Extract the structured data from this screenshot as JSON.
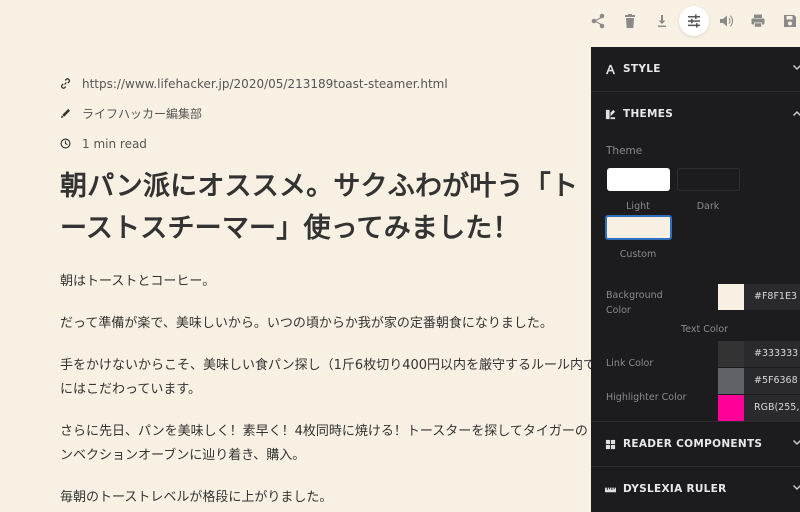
{
  "toolbar": {
    "buttons": [
      {
        "name": "share-icon",
        "label": "share"
      },
      {
        "name": "trash-icon",
        "label": "delete"
      },
      {
        "name": "download-icon",
        "label": "download"
      },
      {
        "name": "sliders-icon",
        "label": "settings"
      },
      {
        "name": "speaker-icon",
        "label": "read aloud"
      },
      {
        "name": "print-icon",
        "label": "print"
      },
      {
        "name": "save-icon",
        "label": "save"
      }
    ]
  },
  "article": {
    "url": "https://www.lifehacker.jp/2020/05/213189toast-steamer.html",
    "author": "ライフハッカー編集部",
    "read_time": "1 min read",
    "title_line1": "朝パン派にオススメ。サクふわが叶う「ト",
    "title_line2": "ーストスチーマー」使ってみました！",
    "paragraphs": [
      "朝はトーストとコーヒー。",
      "だって準備が楽で、美味しいから。いつの頃からか我が家の定番朝食になりました。",
      "手をかけないからこそ、美味しい食パン探し（1斤6枚切り400円以内を厳守するルール内で",
      "にはこだわっています。",
      "さらに先日、パンを美味しく！素早く！4枚同時に焼ける！トースターを探してタイガーの",
      "ンベクションオーブンに辿り着き、購入。",
      "毎朝のトーストレベルが格段に上がりました。"
    ]
  },
  "panel": {
    "style_label": "STYLE",
    "themes_label": "THEMES",
    "theme_heading": "Theme",
    "themes": [
      {
        "label": "Light",
        "color": "#FFFFFF"
      },
      {
        "label": "Dark",
        "color": "#1C1C1F"
      },
      {
        "label": "Custom",
        "color": "#F8F1E3"
      }
    ],
    "background_color_label": "Background Color",
    "background_color_value": "#F8F1E3",
    "text_color_label": "Text Color",
    "text_color_value": "#333333",
    "link_color_label": "Link Color",
    "link_color_value": "#5F6368",
    "highlighter_color_label": "Highlighter Color",
    "highlighter_color_value": "RGB(255,",
    "highlighter_color_hex": "#FF0099",
    "reader_components_label": "READER COMPONENTS",
    "dyslexia_ruler_label": "DYSLEXIA RULER"
  }
}
